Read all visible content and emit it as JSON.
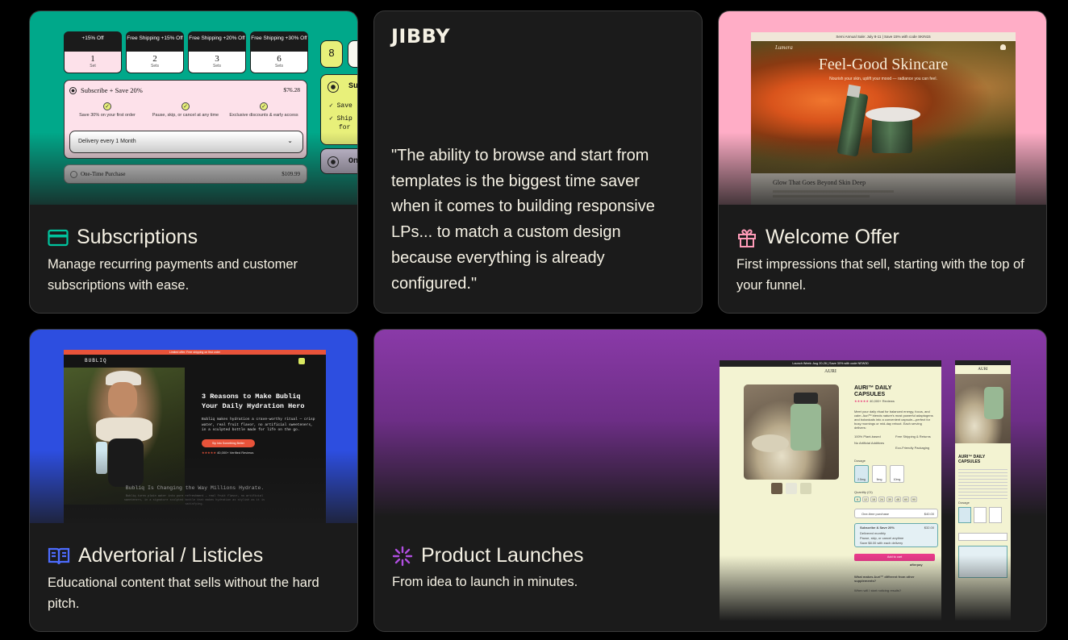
{
  "cards": {
    "subscriptions": {
      "title": "Subscriptions",
      "description": "Manage recurring payments and customer subscriptions with ease.",
      "accent": "#00a88a",
      "mock": {
        "tiers": [
          {
            "head": "+15% Off",
            "num": "1",
            "unit": "Set"
          },
          {
            "head": "Free Shipping +15% Off",
            "num": "2",
            "unit": "Sets"
          },
          {
            "head": "Free Shipping +20% Off",
            "num": "3",
            "unit": "Sets"
          },
          {
            "head": "Free Shipping +30% Off",
            "num": "6",
            "unit": "Sets"
          }
        ],
        "subscribe_label": "Subscribe + Save 20%",
        "subscribe_price": "$76.28",
        "features": [
          "Save 30% on your first order",
          "Pause, skip, or cancel at any time",
          "Exclusive discounts & early access"
        ],
        "delivery_select": "Delivery every 1 Month",
        "one_time_label": "One-Time Purchase",
        "one_time_price": "$109.99",
        "side_pill": "8",
        "side_sub": "Su",
        "side_line1": "Save",
        "side_line2": "Ship",
        "side_line3": "for",
        "side_on": "On"
      }
    },
    "testimonial": {
      "brand": "JIBBY",
      "quote": "\"The ability to browse and start from templates is the biggest time saver when it comes to building responsive LPs... to match a custom design because everything is already configured.\""
    },
    "welcome": {
      "title": "Welcome Offer",
      "description": "First impressions that sell, starting with the top of your funnel.",
      "accent": "#ffadc6",
      "mock": {
        "banner": "Semi Annual Sale: July 8-11 | Save 15% with code SKIN15",
        "logo": "Lumera",
        "headline": "Feel-Good Skincare",
        "subhead": "Nourish your skin, uplift your mood — radiance you can feel.",
        "section_title": "Glow That Goes Beyond Skin Deep"
      }
    },
    "advertorial": {
      "title": "Advertorial / Listicles",
      "description": "Educational content that sells without the hard pitch.",
      "accent": "#2d4ee0",
      "mock": {
        "banner": "Limited offer: Free shipping on first order",
        "logo": "BUBLIQ",
        "headline": "3 Reasons to Make Bubliq Your Daily Hydration Hero",
        "body": "Bubliq makes hydration a crave-worthy ritual — crisp water, real fruit flavor, no artificial sweeteners, in a sculpted bottle made for life on the go.",
        "cta": "Sip Into Something Better",
        "reviews": "40,000+ Verified Reviews",
        "section_title": "Bubliq Is Changing the Way Millions Hydrate.",
        "section_body": "Bubliq turns plain water into pure refreshment — real fruit flavor, no artificial sweeteners, in a signature sculpted bottle that makes hydration as stylish as it is satisfying."
      }
    },
    "launches": {
      "title": "Product Launches",
      "description": "From idea to launch in minutes.",
      "accent": "#8a3aa8",
      "mock": {
        "banner": "Launch Week: Aug 20-26 | Save 30% with code NEW30",
        "logo": "AURI",
        "product": "AURI™ DAILY CAPSULES",
        "reviews": "40,000+ Reviews",
        "description": "Meet your daily ritual for balanced energy, focus, and calm. Auri™ blends nature's most powerful adaptogens and botanicals into a convenient capsule—perfect for busy mornings or mid-day reboot. Each serving delivers:",
        "benefits": [
          "100% Plant-based",
          "Free Shipping & Returns",
          "No Artificial Additives",
          "Eco-Friendly Packaging"
        ],
        "dosage_label": "Dosage",
        "dosages": [
          "2.5mg",
          "5mg",
          "10mg"
        ],
        "quantity_label": "Quantity (Ct)",
        "quantities": [
          "6",
          "12",
          "18",
          "24",
          "30",
          "48",
          "60",
          "90"
        ],
        "one_time": "One-time purchase",
        "one_time_price": "$40.00",
        "subscribe": "Subscribe & Save 20%",
        "subscribe_price": "$32.00",
        "sub_points": [
          "Delivered monthly",
          "Pause, skip, or cancel anytime",
          "Save $8.00 with each delivery"
        ],
        "add_to_cart": "Add to cart",
        "afterpay": "afterpay",
        "faq1": "What makes Auri™ different from other supplements?",
        "faq2": "When will I start noticing results?"
      }
    }
  }
}
